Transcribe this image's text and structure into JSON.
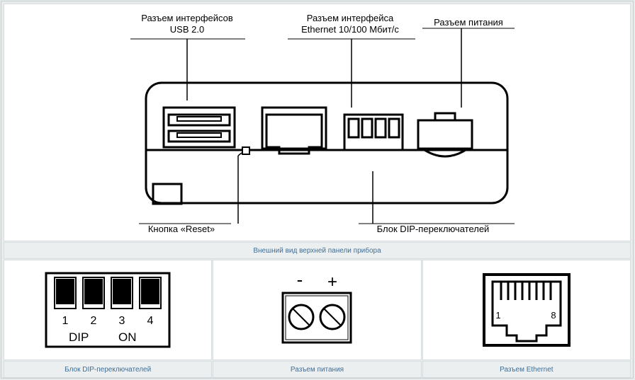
{
  "main_diagram": {
    "caption": "Внешний вид верхней панели прибора",
    "callouts": {
      "usb": "Разъем интерфейсов\nUSB 2.0",
      "ethernet": "Разъем интерфейса\nEthernet 10/100 Мбит/с",
      "power": "Разъем питания",
      "reset": "Кнопка «Reset»",
      "dip": "Блок DIP-переключателей"
    }
  },
  "detail1": {
    "caption": "Блок DIP-переключателей",
    "switches": [
      "1",
      "2",
      "3",
      "4"
    ],
    "label_left": "DIP",
    "label_right": "ON"
  },
  "detail2": {
    "caption": "Разъем питания",
    "minus": "-",
    "plus": "+"
  },
  "detail3": {
    "caption": "Разъем Ethernet",
    "pin_first": "1",
    "pin_last": "8"
  }
}
